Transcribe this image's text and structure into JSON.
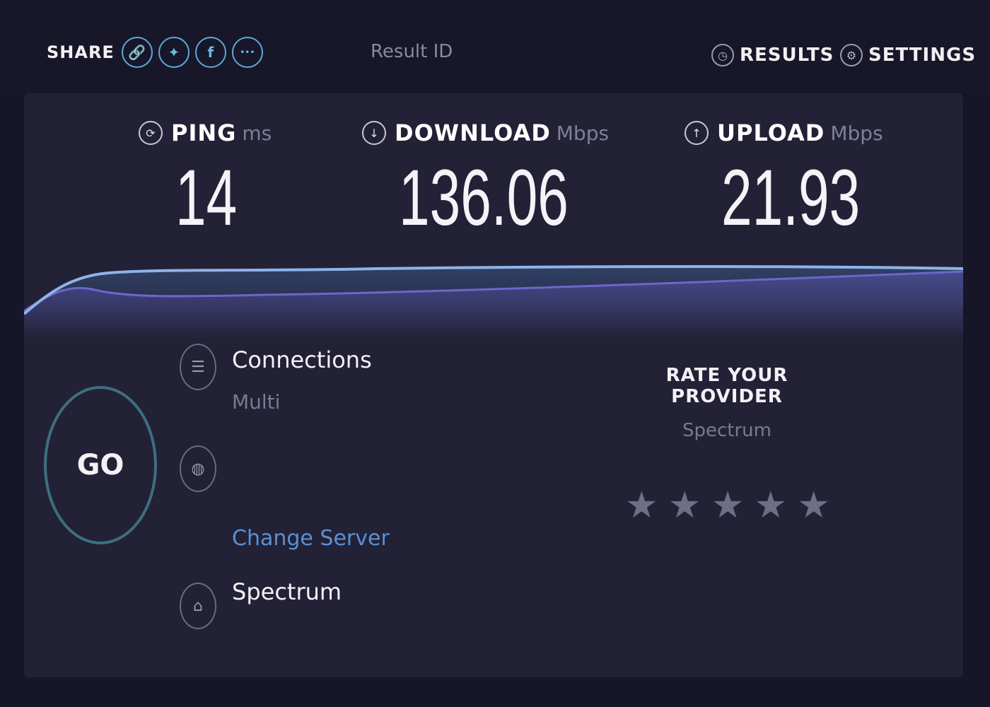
{
  "header": {
    "share_label": "SHARE",
    "share_buttons": [
      {
        "icon": "link-icon",
        "glyph": "🔗"
      },
      {
        "icon": "twitter-icon",
        "glyph": "✦"
      },
      {
        "icon": "facebook-icon",
        "glyph": "f"
      },
      {
        "icon": "more-icon",
        "glyph": "•••"
      }
    ],
    "result_id": "Result ID",
    "results_label": "RESULTS",
    "settings_label": "SETTINGS"
  },
  "metrics": {
    "ping": {
      "name": "PING",
      "unit": "ms",
      "value": "14"
    },
    "download": {
      "name": "DOWNLOAD",
      "unit": "Mbps",
      "value": "136.06"
    },
    "upload": {
      "name": "UPLOAD",
      "unit": "Mbps",
      "value": "21.93"
    }
  },
  "colors": {
    "accent_download": "#8fb3e8",
    "accent_upload": "#7b5fd0",
    "background": "#222136"
  },
  "connections": {
    "label": "Connections",
    "value": "Multi"
  },
  "server": {
    "change_label": "Change Server"
  },
  "isp": {
    "name": "Spectrum"
  },
  "rating": {
    "title": "RATE YOUR PROVIDER",
    "provider": "Spectrum",
    "stars_total": 5,
    "stars_filled": 0
  },
  "go_label": "GO"
}
